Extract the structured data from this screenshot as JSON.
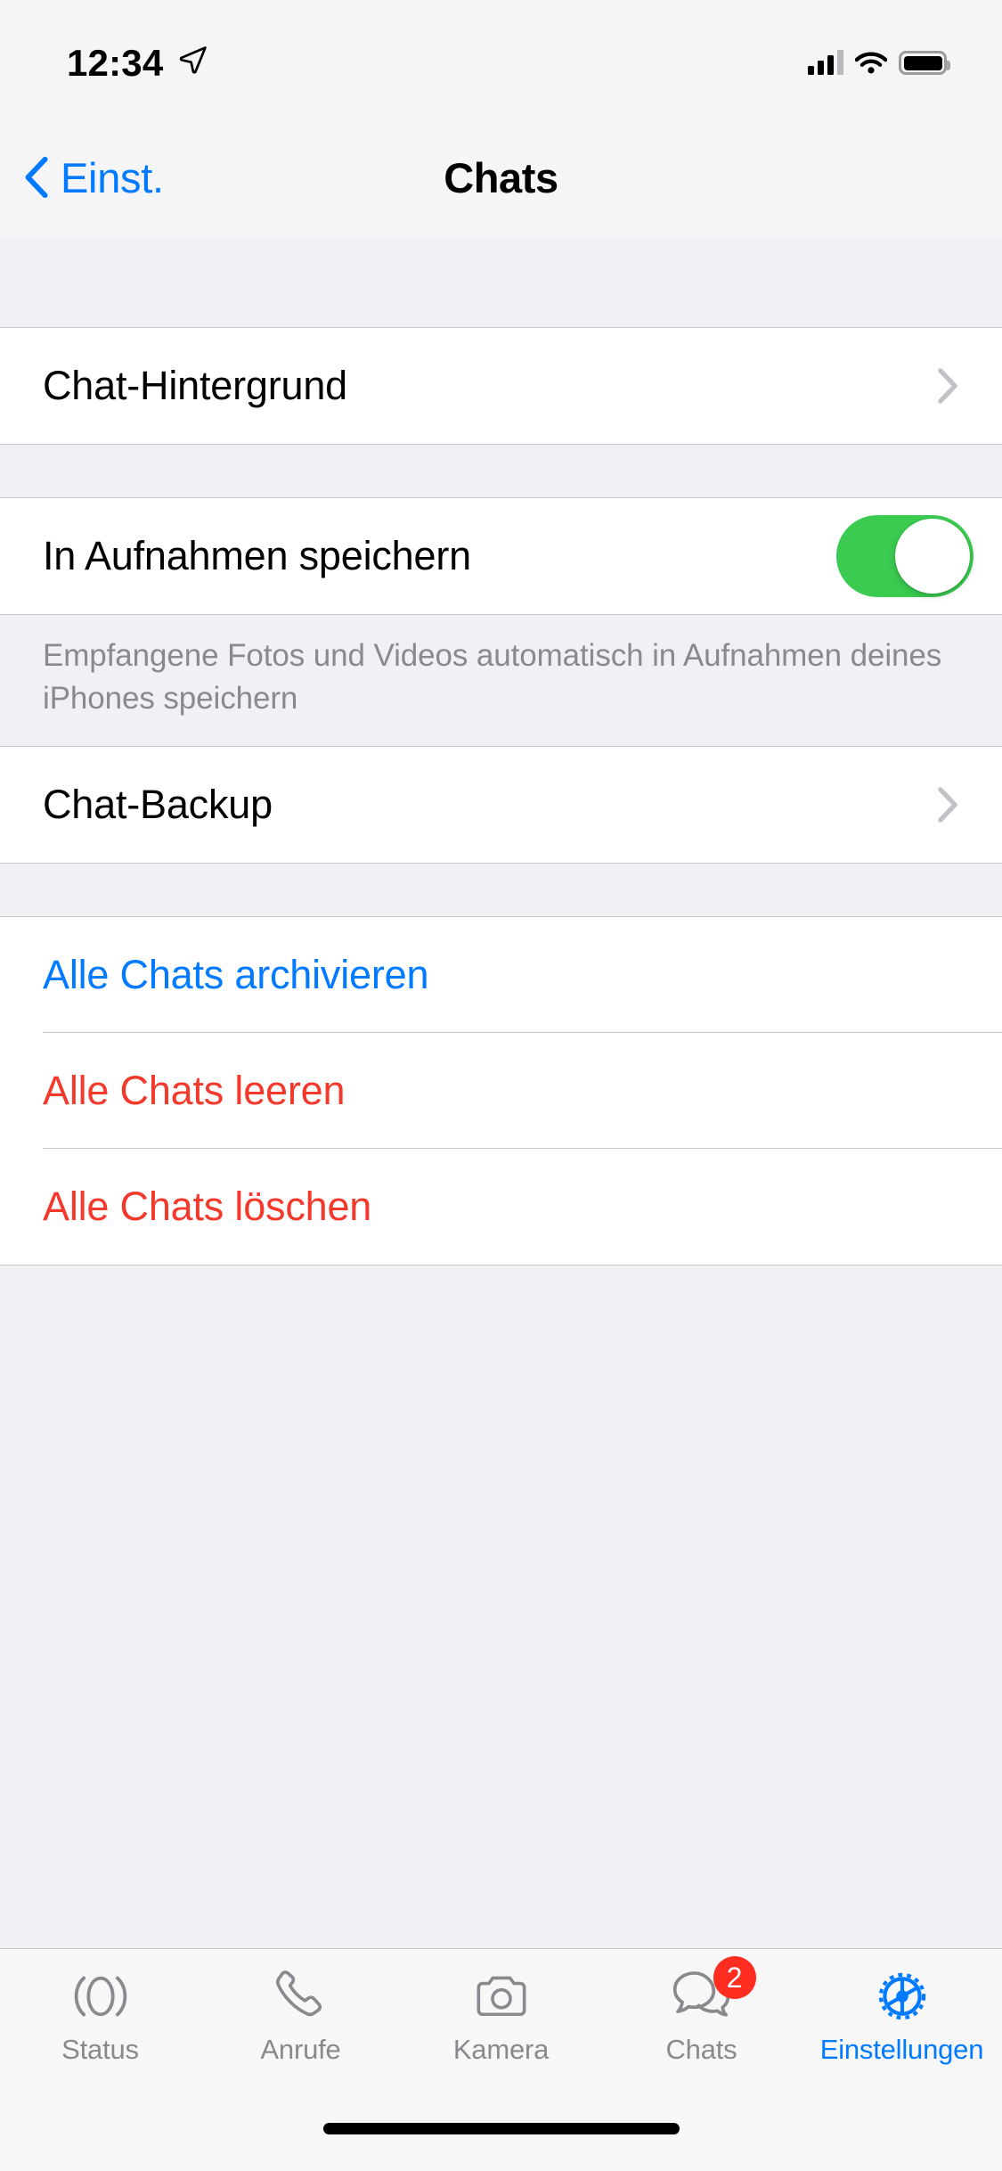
{
  "status_bar": {
    "time": "12:34",
    "location_icon": "location-arrow-icon",
    "signal_icon": "cellular-signal-icon",
    "wifi_icon": "wifi-icon",
    "battery_icon": "battery-icon"
  },
  "nav_bar": {
    "back_label": "Einst.",
    "back_icon": "chevron-left-icon",
    "title": "Chats"
  },
  "sections": [
    {
      "rows": [
        {
          "label": "Chat-Hintergrund",
          "accessory": "chevron-right-icon"
        }
      ]
    },
    {
      "rows": [
        {
          "label": "In Aufnahmen speichern",
          "accessory": "toggle",
          "toggle_on": true
        }
      ],
      "footer": "Empfangene Fotos und Videos automatisch in Aufnahmen deines iPhones speichern"
    },
    {
      "rows": [
        {
          "label": "Chat-Backup",
          "accessory": "chevron-right-icon"
        }
      ]
    },
    {
      "rows": [
        {
          "label": "Alle Chats archivieren",
          "style": "blue"
        },
        {
          "label": "Alle Chats leeren",
          "style": "red"
        },
        {
          "label": "Alle Chats löschen",
          "style": "red"
        }
      ]
    }
  ],
  "tab_bar": {
    "items": [
      {
        "label": "Status",
        "icon": "status-rings-icon",
        "active": false
      },
      {
        "label": "Anrufe",
        "icon": "phone-icon",
        "active": false
      },
      {
        "label": "Kamera",
        "icon": "camera-icon",
        "active": false
      },
      {
        "label": "Chats",
        "icon": "chat-bubbles-icon",
        "active": false,
        "badge": "2"
      },
      {
        "label": "Einstellungen",
        "icon": "gear-icon",
        "active": true
      }
    ]
  },
  "colors": {
    "accent_blue": "#007AFF",
    "destructive_red": "#F2392C",
    "toggle_green": "#3ACB50",
    "badge_red": "#FF2D20",
    "group_background": "#F1F1F5",
    "cell_background": "#FFFFFF",
    "secondary_text": "#8A8A8E"
  }
}
